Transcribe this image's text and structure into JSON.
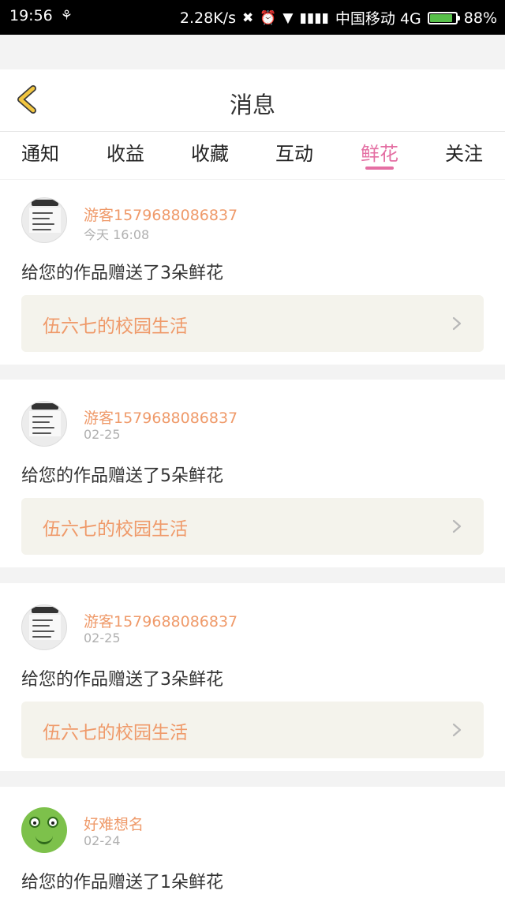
{
  "status_bar": {
    "time": "19:56",
    "speed": "2.28K/s",
    "carrier": "中国移动 4G",
    "battery": "88%",
    "battery_level": 0.88
  },
  "header": {
    "title": "消息",
    "back_icon": "chevron-left-icon"
  },
  "tabs": [
    {
      "label": "通知"
    },
    {
      "label": "收益"
    },
    {
      "label": "收藏"
    },
    {
      "label": "互动"
    },
    {
      "label": "鲜花"
    },
    {
      "label": "关注"
    }
  ],
  "active_tab": "鲜花",
  "notifications": [
    {
      "username": "游客1579688086837",
      "time": "今天 16:08",
      "message": "给您的作品赠送了3朵鲜花",
      "work": "伍六七的校园生活"
    },
    {
      "username": "游客1579688086837",
      "time": "02-25",
      "message": "给您的作品赠送了5朵鲜花",
      "work": "伍六七的校园生活"
    },
    {
      "username": "游客1579688086837",
      "time": "02-25",
      "message": "给您的作品赠送了3朵鲜花",
      "work": "伍六七的校园生活"
    },
    {
      "username": "好难想名",
      "time": "02-24",
      "message": "给您的作品赠送了1朵鲜花",
      "work": ""
    }
  ],
  "colors": {
    "accent": "#e46fa3",
    "username": "#ef9a6a",
    "work_bg": "#f4f3ec",
    "back_icon": "#f2c640"
  }
}
